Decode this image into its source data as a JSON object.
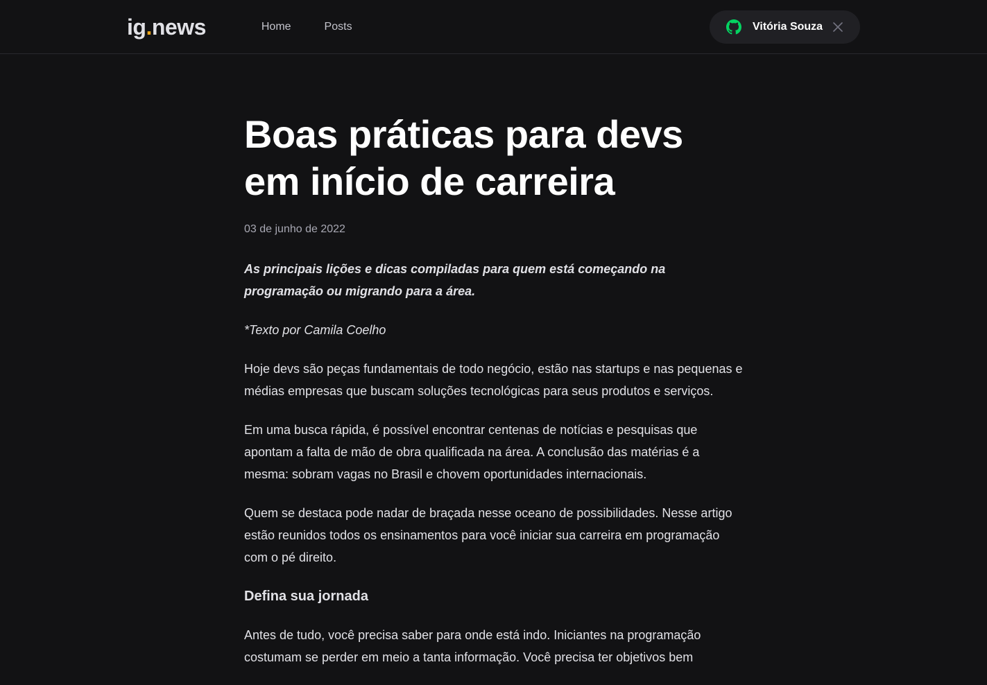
{
  "header": {
    "logo_text": "ig",
    "logo_dot": ".",
    "logo_rest": "news",
    "nav": [
      {
        "label": "Home"
      },
      {
        "label": "Posts"
      }
    ],
    "user": {
      "name": "Vitória Souza",
      "icon": "github-icon",
      "close_icon": "close-icon",
      "accent": "#04d361"
    }
  },
  "article": {
    "title": "Boas práticas para devs em início de carreira",
    "date": "03 de junho de 2022",
    "lead": "As principais lições e dicas compiladas para quem está começando na programação ou migrando para a área.",
    "byline": "*Texto por Camila Coelho",
    "paragraphs": [
      "Hoje devs são peças fundamentais de todo negócio, estão nas startups e nas pequenas e médias empresas que buscam soluções tecnológicas para seus produtos e serviços.",
      "Em uma busca rápida, é possível encontrar centenas de notícias e pesquisas que apontam a falta de mão de obra qualificada na área. A conclusão das matérias é a mesma: sobram vagas no Brasil e chovem oportunidades internacionais.",
      "Quem se destaca pode nadar de braçada nesse oceano de possibilidades. Nesse artigo estão reunidos todos os ensinamentos para você iniciar sua carreira em programação com o pé direito."
    ],
    "section_heading": "Defina sua jornada",
    "section_paragraph": "Antes de tudo, você precisa saber para onde está indo. Iniciantes na programação costumam se perder em meio a tanta informação. Você precisa ter objetivos bem"
  }
}
